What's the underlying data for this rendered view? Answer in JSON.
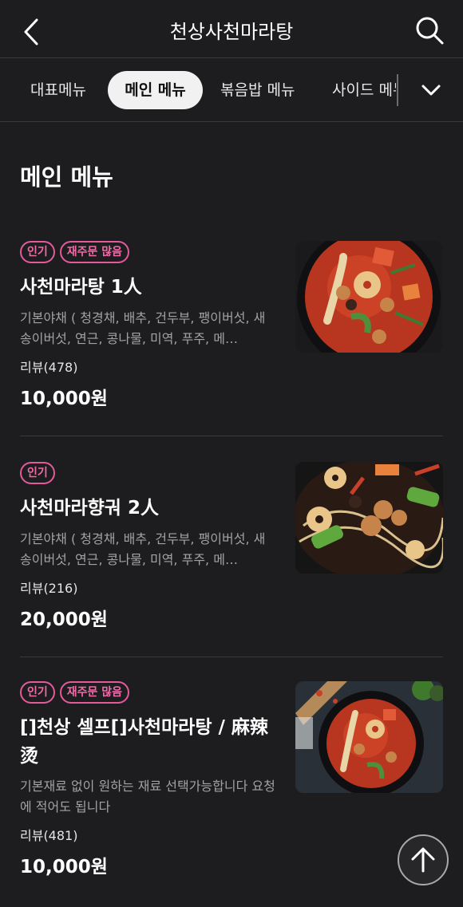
{
  "header": {
    "title": "천상사천마라탕",
    "back_icon": "chevron-left-icon",
    "search_icon": "search-icon"
  },
  "tabs": [
    {
      "label": "대표메뉴",
      "active": false
    },
    {
      "label": "메인 메뉴",
      "active": true
    },
    {
      "label": "볶음밥 메뉴",
      "active": false
    },
    {
      "label": "사이드 메뉴",
      "active": false
    }
  ],
  "tabs_more_icon": "chevron-down-icon",
  "section": {
    "title": "메인 메뉴"
  },
  "items": [
    {
      "badges": [
        "인기",
        "재주문 많음"
      ],
      "name": "사천마라탕 1人",
      "desc": "기본야채 ( 청경채, 배추, 건두부, 팽이버섯, 새송이버섯, 연근, 콩나물, 미역, 푸주, 메…",
      "review": "리뷰(478)",
      "price": "10,000원"
    },
    {
      "badges": [
        "인기"
      ],
      "name": "사천마라향궈 2人",
      "desc": "기본야채 ( 청경채, 배추, 건두부, 팽이버섯, 새송이버섯, 연근, 콩나물, 미역, 푸주, 메…",
      "review": "리뷰(216)",
      "price": "20,000원"
    },
    {
      "badges": [
        "인기",
        "재주문 많음"
      ],
      "name": "[]천상 셀프[]사천마라탕 / 麻辣烫",
      "desc": "기본재료 없이 원하는 재료 선택가능합니다 요청에 적어도 됩니다",
      "review": "리뷰(481)",
      "price": "10,000원"
    }
  ],
  "scroll_top_icon": "arrow-up-icon",
  "colors": {
    "background": "#1d1d1f",
    "badge": "#e25a9a",
    "active_tab_bg": "#f1f1f1"
  }
}
